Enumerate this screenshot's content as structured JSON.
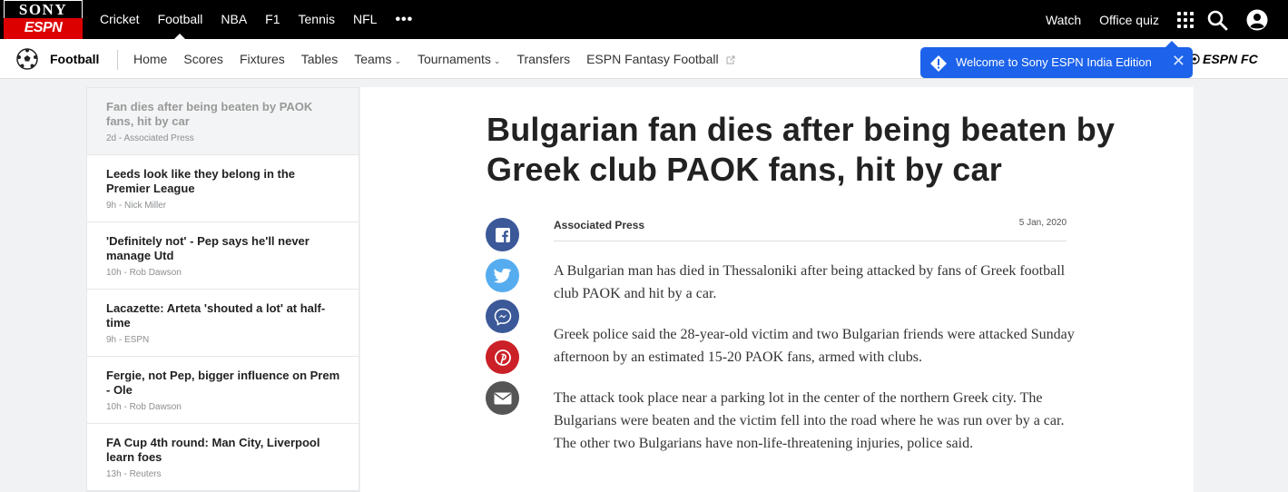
{
  "brand": {
    "top": "SONY",
    "bottom": "ESPN"
  },
  "topnav": {
    "items": [
      "Cricket",
      "Football",
      "NBA",
      "F1",
      "Tennis",
      "NFL"
    ],
    "active": "Football",
    "more": "•••",
    "right": [
      "Watch",
      "Office quiz"
    ],
    "icons": [
      "apps-grid-icon",
      "search-icon",
      "user-account-icon"
    ]
  },
  "subnav": {
    "sport": "Football",
    "links": [
      "Home",
      "Scores",
      "Fixtures",
      "Tables",
      "Teams",
      "Tournaments",
      "Transfers",
      "ESPN Fantasy Football"
    ],
    "dropdowns": [
      "Teams",
      "Tournaments"
    ],
    "partner_logo": "ESPN FC"
  },
  "toast": {
    "message": "Welcome to Sony ESPN India Edition",
    "color": "#1c62ea"
  },
  "sidebar": {
    "stories": [
      {
        "headline": "Fan dies after being beaten by PAOK fans, hit by car",
        "meta": "2d - Associated Press",
        "current": true
      },
      {
        "headline": "Leeds look like they belong in the Premier League",
        "meta": "9h - Nick Miller"
      },
      {
        "headline": "'Definitely not' - Pep says he'll never manage Utd",
        "meta": "10h - Rob Dawson"
      },
      {
        "headline": "Lacazette: Arteta 'shouted a lot' at half-time",
        "meta": "9h - ESPN"
      },
      {
        "headline": "Fergie, not Pep, bigger influence on Prem - Ole",
        "meta": "10h - Rob Dawson"
      },
      {
        "headline": "FA Cup 4th round: Man City, Liverpool learn foes",
        "meta": "13h - Reuters"
      }
    ]
  },
  "article": {
    "headline": "Bulgarian fan dies after being beaten by Greek club PAOK fans, hit by car",
    "author": "Associated Press",
    "date": "5 Jan, 2020",
    "paragraphs": [
      "A Bulgarian man has died in Thessaloniki after being attacked by fans of Greek football club PAOK and hit by a car.",
      "Greek police said the 28-year-old victim and two Bulgarian friends were attacked Sunday afternoon by an estimated 15-20 PAOK fans, armed with clubs.",
      "The attack took place near a parking lot in the center of the northern Greek city. The Bulgarians were beaten and the victim fell into the road where he was run over by a car. The other two Bulgarians have non-life-threatening injuries, police said."
    ],
    "share": [
      {
        "name": "facebook-share-icon",
        "color": "#3b5998"
      },
      {
        "name": "twitter-share-icon",
        "color": "#55acee"
      },
      {
        "name": "messenger-share-icon",
        "color": "#3b5998"
      },
      {
        "name": "pinterest-share-icon",
        "color": "#cb2027"
      },
      {
        "name": "email-share-icon",
        "color": "#555555"
      }
    ]
  }
}
